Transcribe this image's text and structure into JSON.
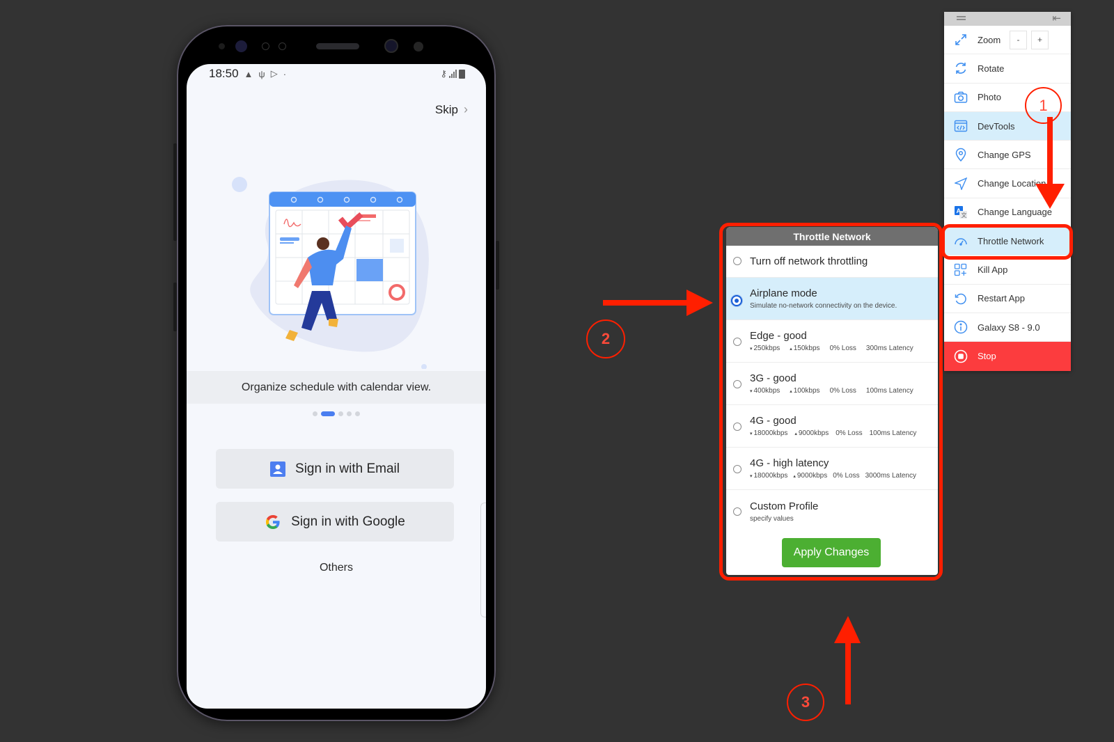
{
  "phone": {
    "status_bar": {
      "time": "18:50",
      "left_icons": [
        "warning-icon",
        "usb-icon",
        "play-store-icon",
        "dot-icon"
      ],
      "right_icons": [
        "vpn-key-icon",
        "signal-icon",
        "battery-icon"
      ]
    },
    "skip_label": "Skip",
    "onboarding": {
      "caption": "Organize schedule with calendar view.",
      "page_count": 5,
      "active_page": 2
    },
    "buttons": {
      "email": "Sign in with Email",
      "google": "Sign in with Google",
      "others": "Others"
    }
  },
  "throttle_panel": {
    "title": "Throttle Network",
    "options": [
      {
        "title": "Turn off network throttling",
        "selected": false
      },
      {
        "title": "Airplane mode",
        "description": "Simulate no-network connectivity on the device.",
        "selected": true
      },
      {
        "title": "Edge - good",
        "download": "250kbps",
        "upload": "150kbps",
        "loss": "0% Loss",
        "latency": "300ms Latency",
        "selected": false
      },
      {
        "title": "3G - good",
        "download": "400kbps",
        "upload": "100kbps",
        "loss": "0% Loss",
        "latency": "100ms Latency",
        "selected": false
      },
      {
        "title": "4G - good",
        "download": "18000kbps",
        "upload": "9000kbps",
        "loss": "0% Loss",
        "latency": "100ms Latency",
        "selected": false
      },
      {
        "title": "4G - high latency",
        "download": "18000kbps",
        "upload": "9000kbps",
        "loss": "0% Loss",
        "latency": "3000ms Latency",
        "selected": false
      },
      {
        "title": "Custom Profile",
        "description": "specify values",
        "selected": false
      }
    ],
    "apply_label": "Apply Changes"
  },
  "toolbar": {
    "items": [
      {
        "label": "Zoom",
        "icon": "expand-icon",
        "zoom_out": "-",
        "zoom_in": "+"
      },
      {
        "label": "Rotate",
        "icon": "rotate-icon"
      },
      {
        "label": "Photo",
        "icon": "camera-icon"
      },
      {
        "label": "DevTools",
        "icon": "devtools-icon",
        "active": true
      },
      {
        "label": "Change GPS",
        "icon": "location-pin-icon"
      },
      {
        "label": "Change Location",
        "icon": "navigation-arrow-icon"
      },
      {
        "label": "Change Language",
        "icon": "translate-icon"
      },
      {
        "label": "Throttle Network",
        "icon": "speedometer-icon",
        "active": true
      },
      {
        "label": "Kill App",
        "icon": "apps-grid-icon"
      },
      {
        "label": "Restart App",
        "icon": "restart-icon"
      },
      {
        "label": "Galaxy S8 - 9.0",
        "icon": "info-icon"
      },
      {
        "label": "Stop",
        "icon": "stop-icon"
      }
    ]
  },
  "annotations": {
    "step1": "1",
    "step2": "2",
    "step3": "3",
    "color": "#ff1f00"
  },
  "colors": {
    "background": "#333333",
    "accent_blue": "#3f8ff0",
    "selected_bg": "#d6eefb",
    "apply_green": "#4caf32",
    "stop_red": "#fc3c3e",
    "annotation_red": "#ff1f00"
  }
}
